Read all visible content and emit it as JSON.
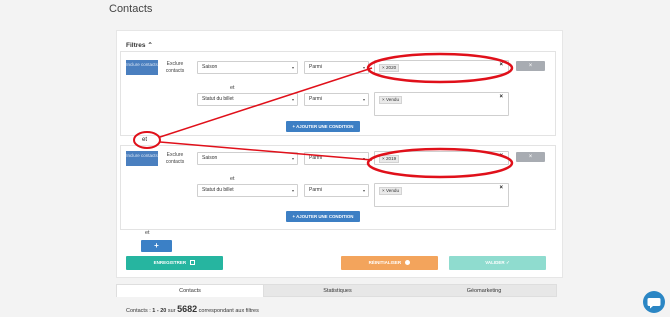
{
  "page": {
    "title": "Contacts"
  },
  "filters": {
    "title": "Filtres",
    "groups": [
      {
        "include_label": "Inclure contacts",
        "exclude_label": "Exclure contacts",
        "conditions": [
          {
            "field": "Saison",
            "operator": "Parmi",
            "tag": "2020"
          },
          {
            "field": "Statut du billet",
            "operator": "Parmi",
            "tag": "Vendu"
          }
        ],
        "and_label": "et",
        "add_condition_label": "AJOUTER UNE CONDITION"
      },
      {
        "include_label": "Inclure contacts",
        "exclude_label": "Exclure contacts",
        "conditions": [
          {
            "field": "Saison",
            "operator": "Parmi",
            "tag": "2019"
          },
          {
            "field": "Statut du billet",
            "operator": "Parmi",
            "tag": "Vendu"
          }
        ],
        "and_label": "et",
        "add_condition_label": "AJOUTER UNE CONDITION"
      }
    ],
    "group_connector_label": "et",
    "bottom_and_label": "et",
    "add_group_label": "+",
    "delete_label": "×",
    "clear_label": "×"
  },
  "actions": {
    "save_label": "ENREGISTRER",
    "reset_label": "RÉINITIALISER",
    "validate_label": "VALIDER"
  },
  "tabs": [
    "Contacts",
    "Statistiques",
    "Géomarketing"
  ],
  "summary": {
    "prefix": "Contacts :",
    "range": "1 - 20",
    "sur": "sur",
    "total": "5682",
    "suffix": "correspondant aux filtres"
  },
  "colors": {
    "annotation": "#e0101a",
    "primary": "#3d7fc4",
    "save": "#26b5a0",
    "reset": "#f3a45c",
    "validate": "#8fdccf"
  }
}
